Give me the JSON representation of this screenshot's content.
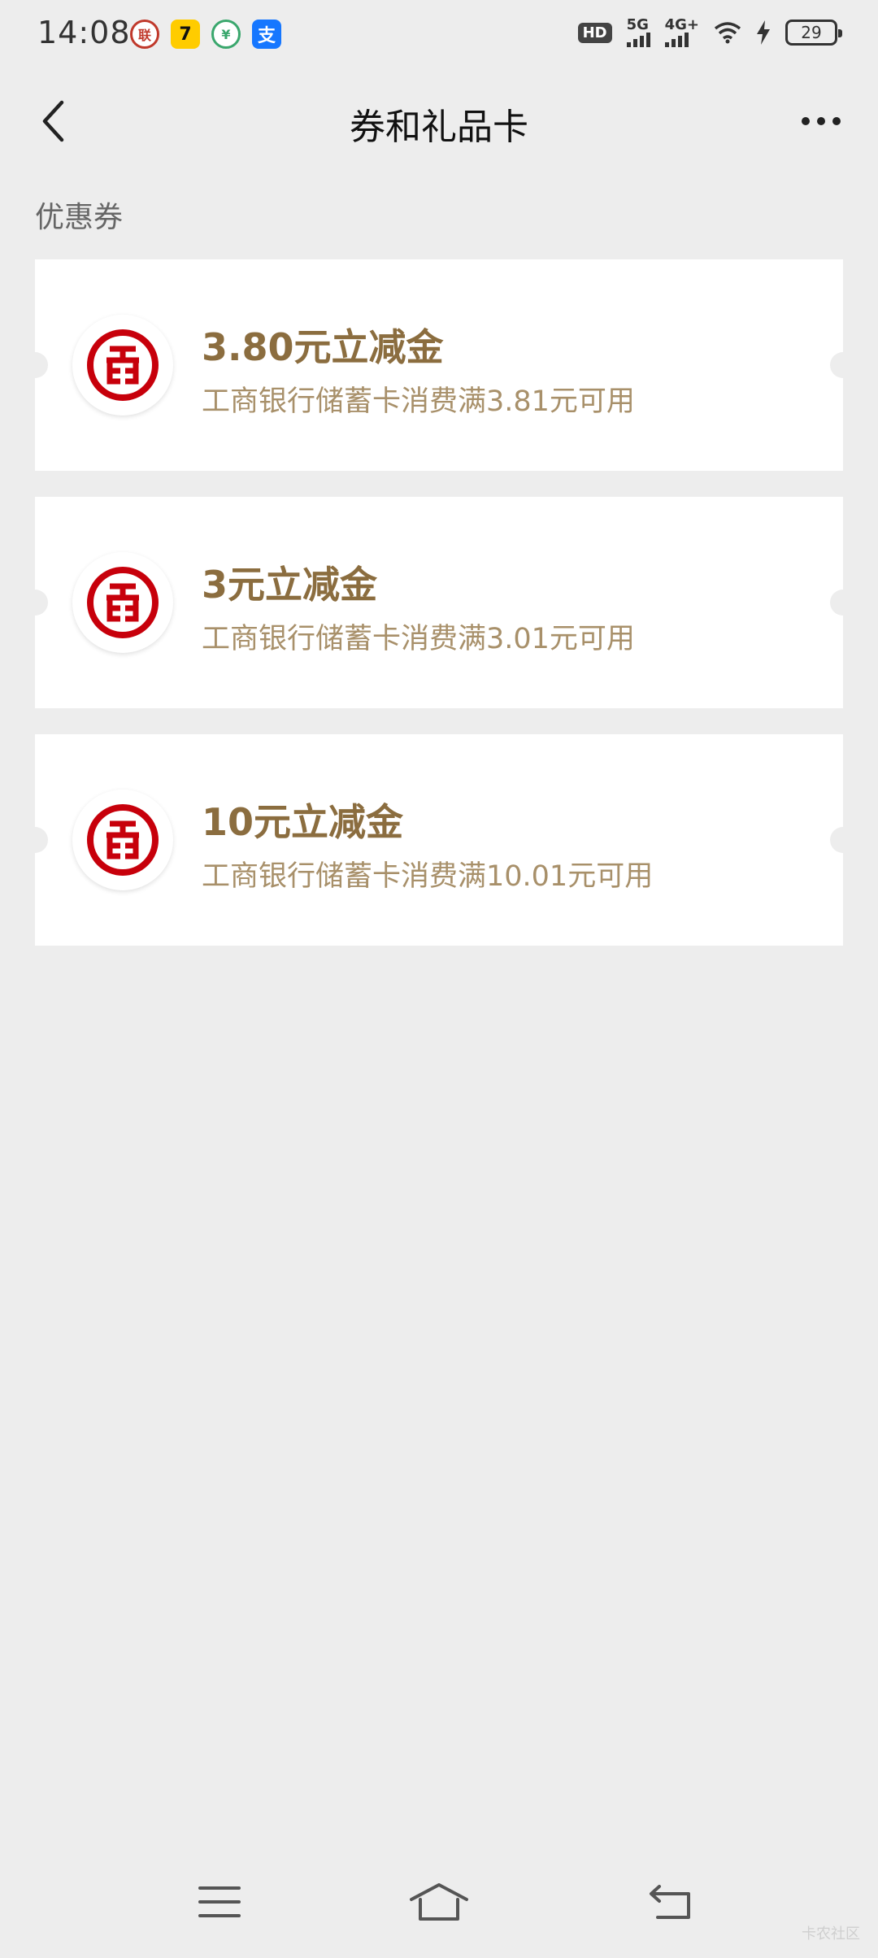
{
  "status_bar": {
    "time": "14:08",
    "app_icons": [
      {
        "name": "unicom-icon",
        "glyph": "联"
      },
      {
        "name": "app-7-icon",
        "glyph": "7"
      },
      {
        "name": "green-app-icon",
        "glyph": "¥"
      },
      {
        "name": "alipay-icon",
        "glyph": "支"
      }
    ],
    "hd": "HD",
    "sim1": "5G",
    "sim2": "4G+",
    "battery": "29"
  },
  "nav": {
    "title": "券和礼品卡"
  },
  "section": {
    "title": "优惠券"
  },
  "coupons": [
    {
      "amount": "3.80元立减金",
      "condition": "工商银行储蓄卡消费满3.81元可用"
    },
    {
      "amount": "3元立减金",
      "condition": "工商银行储蓄卡消费满3.01元可用"
    },
    {
      "amount": "10元立减金",
      "condition": "工商银行储蓄卡消费满10.01元可用"
    }
  ],
  "colors": {
    "background": "#ededed",
    "amount": "#8b6d3f",
    "condition": "#a8906a",
    "icbc_red": "#c7000b"
  },
  "watermark": "卡农社区"
}
